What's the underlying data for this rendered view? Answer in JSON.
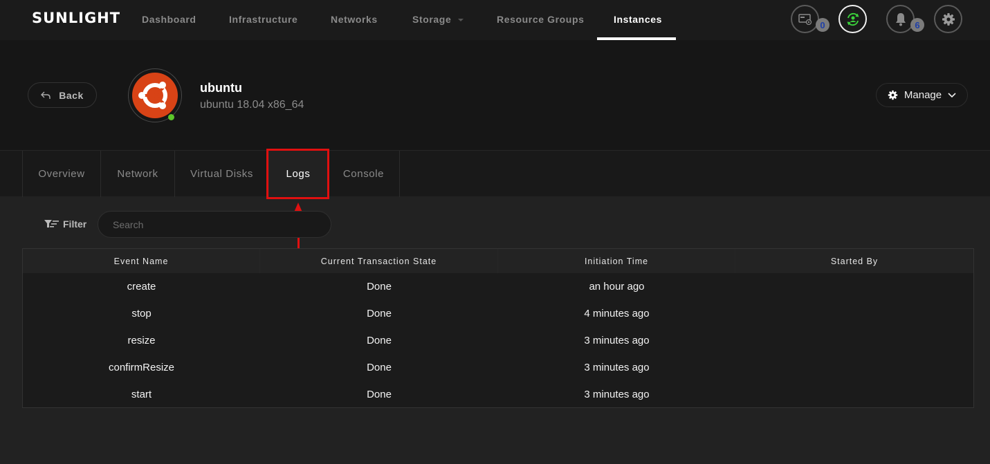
{
  "app": {
    "logo": "SUNLIGHT"
  },
  "nav": {
    "items": [
      {
        "label": "Dashboard"
      },
      {
        "label": "Infrastructure"
      },
      {
        "label": "Networks"
      },
      {
        "label": "Storage",
        "has_dropdown": true
      },
      {
        "label": "Resource Groups"
      },
      {
        "label": "Instances",
        "active": true
      }
    ],
    "icons": {
      "sim_count": "0",
      "notification_count": "6"
    }
  },
  "header": {
    "back_label": "Back",
    "instance_name": "ubuntu",
    "instance_os": "ubuntu 18.04 x86_64",
    "status": "running",
    "manage_label": "Manage"
  },
  "tabs": [
    {
      "label": "Overview"
    },
    {
      "label": "Network"
    },
    {
      "label": "Virtual Disks"
    },
    {
      "label": "Logs",
      "active": true
    },
    {
      "label": "Console"
    }
  ],
  "filter": {
    "label": "Filter",
    "search_placeholder": "Search",
    "search_value": ""
  },
  "table": {
    "columns": [
      "Event Name",
      "Current Transaction State",
      "Initiation Time",
      "Started By"
    ],
    "rows": [
      {
        "event": "create",
        "state": "Done",
        "time": "an hour ago",
        "by": ""
      },
      {
        "event": "stop",
        "state": "Done",
        "time": "4 minutes ago",
        "by": ""
      },
      {
        "event": "resize",
        "state": "Done",
        "time": "3 minutes ago",
        "by": ""
      },
      {
        "event": "confirmResize",
        "state": "Done",
        "time": "3 minutes ago",
        "by": ""
      },
      {
        "event": "start",
        "state": "Done",
        "time": "3 minutes ago",
        "by": ""
      }
    ]
  },
  "colors": {
    "accent_red": "#e01010",
    "ubuntu_orange": "#d84316",
    "status_green": "#5cc52a",
    "active_user_green": "#3bd23b"
  }
}
